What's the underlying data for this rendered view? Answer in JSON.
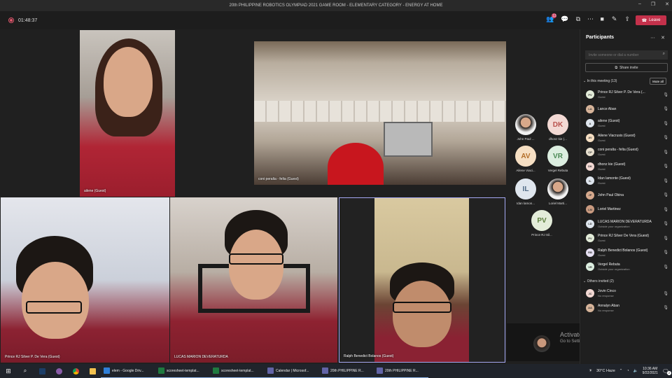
{
  "window": {
    "title": "20th PHILIPPINE ROBOTICS OLYMPIAD 2021 GAME ROOM - ELEMENTARY CATEGORY - ENERGY AT HOME",
    "controls": [
      "–",
      "❐",
      "✕"
    ]
  },
  "toolbar": {
    "timer": "01:48:37",
    "participants_badge": "13",
    "leave_label": "Leave"
  },
  "videos": [
    {
      "label": "ailene (Guest)"
    },
    {
      "label": "coni peralta - felta (Guest)"
    },
    {
      "label": "Prince RJ Silver P. De Vera (Guest)"
    },
    {
      "label": "LUCAS MARION DEVERATURDA"
    },
    {
      "label": "Ralph Benedict Bolanos (Guest)"
    }
  ],
  "gallery": [
    {
      "initials": "",
      "name": "John Paul ...",
      "style": "photo"
    },
    {
      "initials": "DK",
      "name": "dhonz kie (...",
      "style": "dk"
    },
    {
      "initials": "AV",
      "name": "Ailene Viaci...",
      "style": "av"
    },
    {
      "initials": "VR",
      "name": "Vergel Rebuta",
      "style": "vr"
    },
    {
      "initials": "IL",
      "name": "Idan lamon...",
      "style": "il"
    },
    {
      "initials": "",
      "name": "Loriel Marti...",
      "style": "photo"
    },
    {
      "initials": "PV",
      "name": "Prince RJ Sil...",
      "style": "pv"
    }
  ],
  "watermark": {
    "line1": "Activate Windows",
    "line2": "Go to Settings to activate Windows."
  },
  "participants_panel": {
    "title": "Participants",
    "invite_placeholder": "Invite someone or dial a number",
    "share_label": "Share invite",
    "in_meeting_label": "In this meeting (13)",
    "mute_all_label": "Mute all",
    "others_label": "Others invited (2)",
    "in_meeting": [
      {
        "name": "Prince RJ Silver P. De Vera (...",
        "sub": "Guest",
        "initials": "PV",
        "color": "#e3ecd9"
      },
      {
        "name": "Lance Aban",
        "sub": "",
        "initials": "LA",
        "color": "#d7b49a"
      },
      {
        "name": "ailene (Guest)",
        "sub": "Guest",
        "initials": "A",
        "color": "#dfe6ee"
      },
      {
        "name": "Ailene Viacrusis (Guest)",
        "sub": "Guest",
        "initials": "AV",
        "color": "#f6dfc3"
      },
      {
        "name": "coni peralta - felta (Guest)",
        "sub": "Guest",
        "initials": "CP",
        "color": "#e8e0cf"
      },
      {
        "name": "dhonz kie (Guest)",
        "sub": "Guest",
        "initials": "DK",
        "color": "#f3d9d4"
      },
      {
        "name": "Idan lamonte (Guest)",
        "sub": "Guest",
        "initials": "IL",
        "color": "#dfe6ee"
      },
      {
        "name": "John Paul Obina",
        "sub": "",
        "initials": "JP",
        "color": "#d6a98d"
      },
      {
        "name": "Loriel Martinez",
        "sub": "",
        "initials": "LM",
        "color": "#c99a80"
      },
      {
        "name": "LUCAS MARION DEVERATURDA",
        "sub": "Outside your organization",
        "initials": "LD",
        "color": "#dfe6ee"
      },
      {
        "name": "Prince RJ Silver De Vera (Guest)",
        "sub": "Guest",
        "initials": "PV",
        "color": "#e3ecd9"
      },
      {
        "name": "Ralph Benedict Bolanos (Guest)",
        "sub": "Guest",
        "initials": "RB",
        "color": "#e6e0f2"
      },
      {
        "name": "Vergel Rebuta",
        "sub": "Outside your organization",
        "initials": "VR",
        "color": "#dceee0"
      }
    ],
    "others": [
      {
        "name": "Jovin Cinco",
        "sub": "No response",
        "initials": "JC",
        "color": "#f3d9d4"
      },
      {
        "name": "Annalyn Aban",
        "sub": "No response",
        "initials": "AA",
        "color": "#d7b49a"
      }
    ]
  },
  "taskbar": {
    "apps": [
      {
        "label": "elem - Google Driv...",
        "color": "#2f7fd8"
      },
      {
        "label": "scoresheet-templat...",
        "color": "#1f7a3f"
      },
      {
        "label": "scoresheet-templat...",
        "color": "#1f7a3f"
      },
      {
        "label": "Calendar | Microsof...",
        "color": "#6264a7"
      },
      {
        "label": "20th PHILIPPINE R...",
        "color": "#6264a7"
      },
      {
        "label": "20th PHILIPPINE R...",
        "color": "#6264a7"
      }
    ],
    "weather": "30°C  Haze",
    "time": "10:36 AM",
    "date": "9/22/2021",
    "notification_count": "2"
  }
}
